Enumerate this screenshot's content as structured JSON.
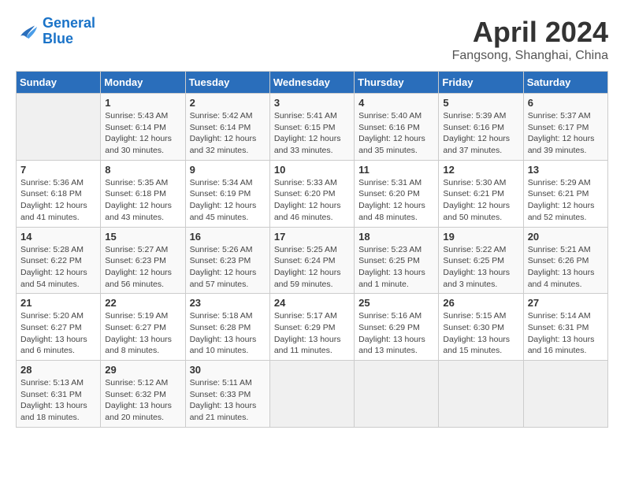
{
  "logo": {
    "line1": "General",
    "line2": "Blue"
  },
  "title": "April 2024",
  "subtitle": "Fangsong, Shanghai, China",
  "days_of_week": [
    "Sunday",
    "Monday",
    "Tuesday",
    "Wednesday",
    "Thursday",
    "Friday",
    "Saturday"
  ],
  "weeks": [
    [
      {
        "day": "",
        "info": ""
      },
      {
        "day": "1",
        "info": "Sunrise: 5:43 AM\nSunset: 6:14 PM\nDaylight: 12 hours\nand 30 minutes."
      },
      {
        "day": "2",
        "info": "Sunrise: 5:42 AM\nSunset: 6:14 PM\nDaylight: 12 hours\nand 32 minutes."
      },
      {
        "day": "3",
        "info": "Sunrise: 5:41 AM\nSunset: 6:15 PM\nDaylight: 12 hours\nand 33 minutes."
      },
      {
        "day": "4",
        "info": "Sunrise: 5:40 AM\nSunset: 6:16 PM\nDaylight: 12 hours\nand 35 minutes."
      },
      {
        "day": "5",
        "info": "Sunrise: 5:39 AM\nSunset: 6:16 PM\nDaylight: 12 hours\nand 37 minutes."
      },
      {
        "day": "6",
        "info": "Sunrise: 5:37 AM\nSunset: 6:17 PM\nDaylight: 12 hours\nand 39 minutes."
      }
    ],
    [
      {
        "day": "7",
        "info": "Sunrise: 5:36 AM\nSunset: 6:18 PM\nDaylight: 12 hours\nand 41 minutes."
      },
      {
        "day": "8",
        "info": "Sunrise: 5:35 AM\nSunset: 6:18 PM\nDaylight: 12 hours\nand 43 minutes."
      },
      {
        "day": "9",
        "info": "Sunrise: 5:34 AM\nSunset: 6:19 PM\nDaylight: 12 hours\nand 45 minutes."
      },
      {
        "day": "10",
        "info": "Sunrise: 5:33 AM\nSunset: 6:20 PM\nDaylight: 12 hours\nand 46 minutes."
      },
      {
        "day": "11",
        "info": "Sunrise: 5:31 AM\nSunset: 6:20 PM\nDaylight: 12 hours\nand 48 minutes."
      },
      {
        "day": "12",
        "info": "Sunrise: 5:30 AM\nSunset: 6:21 PM\nDaylight: 12 hours\nand 50 minutes."
      },
      {
        "day": "13",
        "info": "Sunrise: 5:29 AM\nSunset: 6:21 PM\nDaylight: 12 hours\nand 52 minutes."
      }
    ],
    [
      {
        "day": "14",
        "info": "Sunrise: 5:28 AM\nSunset: 6:22 PM\nDaylight: 12 hours\nand 54 minutes."
      },
      {
        "day": "15",
        "info": "Sunrise: 5:27 AM\nSunset: 6:23 PM\nDaylight: 12 hours\nand 56 minutes."
      },
      {
        "day": "16",
        "info": "Sunrise: 5:26 AM\nSunset: 6:23 PM\nDaylight: 12 hours\nand 57 minutes."
      },
      {
        "day": "17",
        "info": "Sunrise: 5:25 AM\nSunset: 6:24 PM\nDaylight: 12 hours\nand 59 minutes."
      },
      {
        "day": "18",
        "info": "Sunrise: 5:23 AM\nSunset: 6:25 PM\nDaylight: 13 hours\nand 1 minute."
      },
      {
        "day": "19",
        "info": "Sunrise: 5:22 AM\nSunset: 6:25 PM\nDaylight: 13 hours\nand 3 minutes."
      },
      {
        "day": "20",
        "info": "Sunrise: 5:21 AM\nSunset: 6:26 PM\nDaylight: 13 hours\nand 4 minutes."
      }
    ],
    [
      {
        "day": "21",
        "info": "Sunrise: 5:20 AM\nSunset: 6:27 PM\nDaylight: 13 hours\nand 6 minutes."
      },
      {
        "day": "22",
        "info": "Sunrise: 5:19 AM\nSunset: 6:27 PM\nDaylight: 13 hours\nand 8 minutes."
      },
      {
        "day": "23",
        "info": "Sunrise: 5:18 AM\nSunset: 6:28 PM\nDaylight: 13 hours\nand 10 minutes."
      },
      {
        "day": "24",
        "info": "Sunrise: 5:17 AM\nSunset: 6:29 PM\nDaylight: 13 hours\nand 11 minutes."
      },
      {
        "day": "25",
        "info": "Sunrise: 5:16 AM\nSunset: 6:29 PM\nDaylight: 13 hours\nand 13 minutes."
      },
      {
        "day": "26",
        "info": "Sunrise: 5:15 AM\nSunset: 6:30 PM\nDaylight: 13 hours\nand 15 minutes."
      },
      {
        "day": "27",
        "info": "Sunrise: 5:14 AM\nSunset: 6:31 PM\nDaylight: 13 hours\nand 16 minutes."
      }
    ],
    [
      {
        "day": "28",
        "info": "Sunrise: 5:13 AM\nSunset: 6:31 PM\nDaylight: 13 hours\nand 18 minutes."
      },
      {
        "day": "29",
        "info": "Sunrise: 5:12 AM\nSunset: 6:32 PM\nDaylight: 13 hours\nand 20 minutes."
      },
      {
        "day": "30",
        "info": "Sunrise: 5:11 AM\nSunset: 6:33 PM\nDaylight: 13 hours\nand 21 minutes."
      },
      {
        "day": "",
        "info": ""
      },
      {
        "day": "",
        "info": ""
      },
      {
        "day": "",
        "info": ""
      },
      {
        "day": "",
        "info": ""
      }
    ]
  ]
}
